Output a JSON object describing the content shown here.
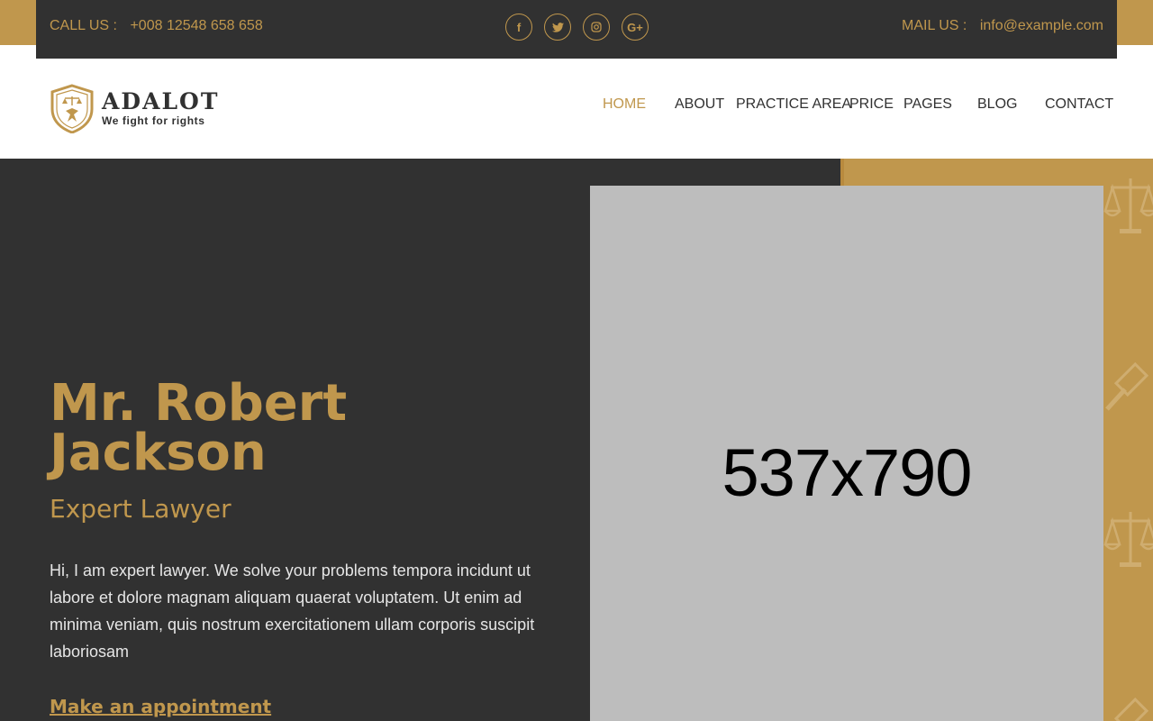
{
  "topbar": {
    "call_label": "CALL US :",
    "phone": "+008 12548 658 658",
    "mail_label": "MAIL US :",
    "email": "info@example.com",
    "socials": [
      {
        "icon": "facebook-icon",
        "glyph": "f"
      },
      {
        "icon": "twitter-icon",
        "glyph": "t"
      },
      {
        "icon": "instagram-icon",
        "glyph": "◎"
      },
      {
        "icon": "google-plus-icon",
        "glyph": "G+"
      }
    ]
  },
  "header": {
    "brand": "ADALOT",
    "tagline": "We fight for rights",
    "nav": [
      "HOME",
      "ABOUT",
      "PRACTICE AREA",
      "PRICE",
      "PAGES",
      "BLOG",
      "CONTACT"
    ],
    "active_nav": "HOME"
  },
  "hero": {
    "name": "Mr. Robert Jackson",
    "role": "Expert Lawyer",
    "description": "Hi, I am expert lawyer. We solve your problems tempora incidunt ut labore et dolore magnam aliquam quaerat voluptatem. Ut enim ad minima veniam, quis nostrum exercitationem ullam corporis suscipit laboriosam",
    "cta": "Make an appointment",
    "image_placeholder": "537x790"
  },
  "colors": {
    "accent": "#c0974d",
    "dark": "#313131",
    "placeholder": "#bdbdbd"
  }
}
